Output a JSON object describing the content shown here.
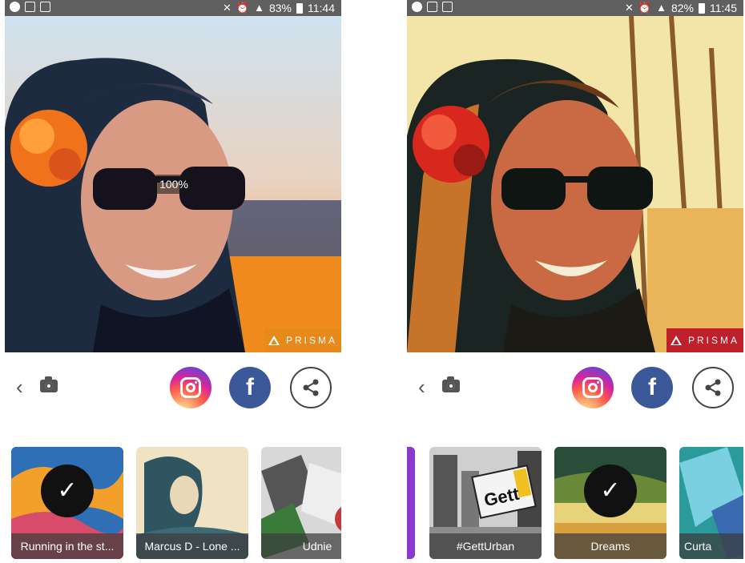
{
  "left": {
    "status": {
      "battery": "83%",
      "time": "11:44"
    },
    "zoom": "100%",
    "watermark": "PRISMA",
    "filters": [
      {
        "label": "Running in the st...",
        "selected": true
      },
      {
        "label": "Marcus D - Lone ...",
        "selected": false
      },
      {
        "label": "Udnie",
        "selected": false
      }
    ]
  },
  "right": {
    "status": {
      "battery": "82%",
      "time": "11:45"
    },
    "watermark": "PRISMA",
    "filters": [
      {
        "label": "#GettUrban",
        "selected": false
      },
      {
        "label": "Dreams",
        "selected": true
      },
      {
        "label": "Curta",
        "selected": false
      }
    ],
    "billboard_text": "Gett"
  },
  "colors": {
    "statusbar": "#5f5f5f",
    "left_watermark_bg": "#e8891c",
    "right_watermark_bg": "#c0202a",
    "facebook": "#3b5998"
  },
  "icons": {
    "back": "chevron-left-icon",
    "camera": "camera-icon",
    "instagram": "instagram-icon",
    "facebook": "facebook-icon",
    "share": "share-icon",
    "check": "checkmark-icon"
  },
  "glyphs": {
    "back": "‹",
    "check": "✓",
    "facebook": "f"
  }
}
